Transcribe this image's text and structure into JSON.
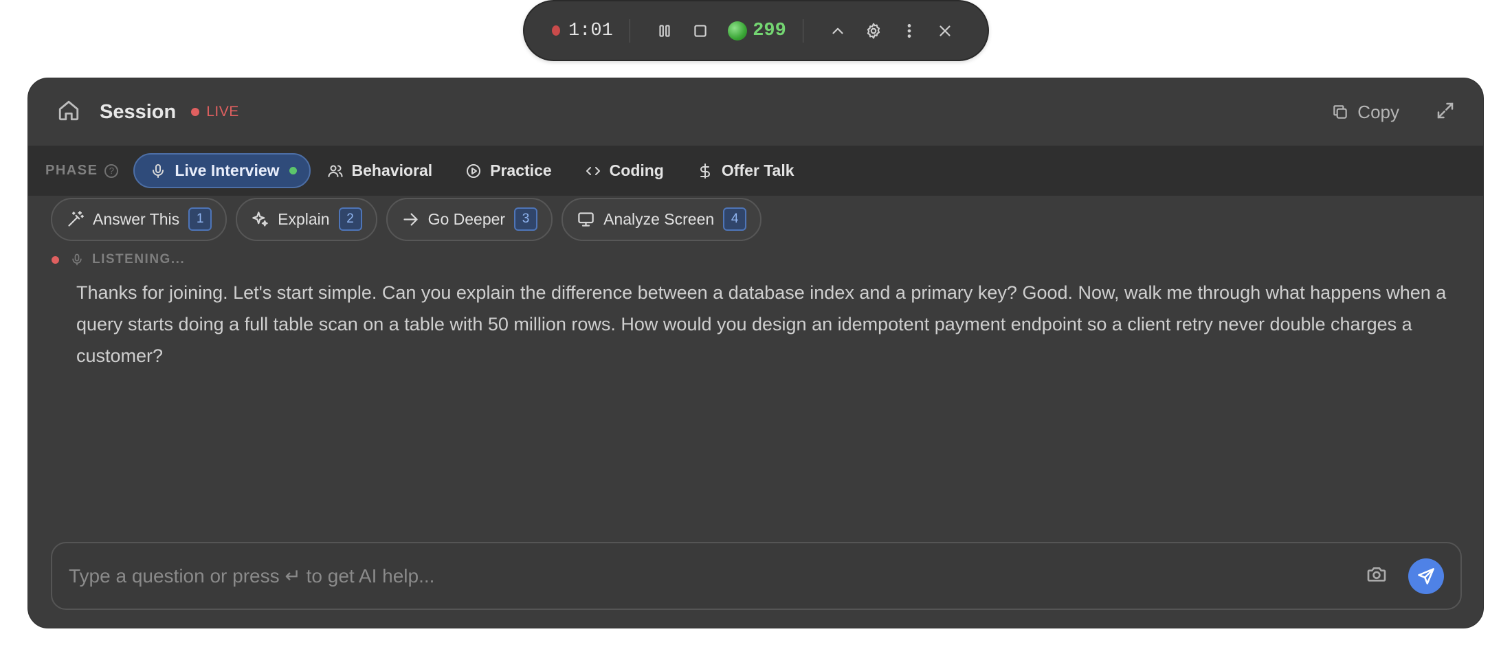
{
  "recorder": {
    "time": "1:01",
    "credits": "299",
    "icons": [
      "record-dot",
      "pause-icon",
      "stop-icon",
      "credit-coin",
      "chevron-up-icon",
      "gear-icon",
      "more-vertical-icon",
      "close-icon"
    ]
  },
  "header": {
    "title": "Session",
    "live_label": "LIVE",
    "copy_label": "Copy"
  },
  "phase": {
    "label": "PHASE",
    "help": "?",
    "tabs": [
      {
        "label": "Live Interview",
        "icon": "mic-icon",
        "active": true
      },
      {
        "label": "Behavioral",
        "icon": "users-icon",
        "active": false
      },
      {
        "label": "Practice",
        "icon": "play-circle-icon",
        "active": false
      },
      {
        "label": "Coding",
        "icon": "code-icon",
        "active": false
      },
      {
        "label": "Offer Talk",
        "icon": "dollar-icon",
        "active": false
      }
    ]
  },
  "actions": [
    {
      "label": "Answer This",
      "key": "1",
      "icon": "magic-wand-icon"
    },
    {
      "label": "Explain",
      "key": "2",
      "icon": "sparkles-icon"
    },
    {
      "label": "Go Deeper",
      "key": "3",
      "icon": "arrow-right-icon"
    },
    {
      "label": "Analyze Screen",
      "key": "4",
      "icon": "monitor-icon"
    }
  ],
  "listening": {
    "label": "LISTENING..."
  },
  "transcript": "Thanks for joining. Let's start simple. Can you explain the difference between a database index and a primary key? Good. Now, walk me through what happens when a query starts doing a full table scan on a table with 50 million rows. How would you design an idempotent payment endpoint so a client retry never double charges a customer?",
  "input": {
    "placeholder": "Type a question or press ↵ to get AI help...",
    "value": ""
  },
  "colors": {
    "accent": "#4f82e6",
    "live": "#e06060",
    "credits": "#74d672",
    "panel_bg": "#3c3c3c"
  }
}
